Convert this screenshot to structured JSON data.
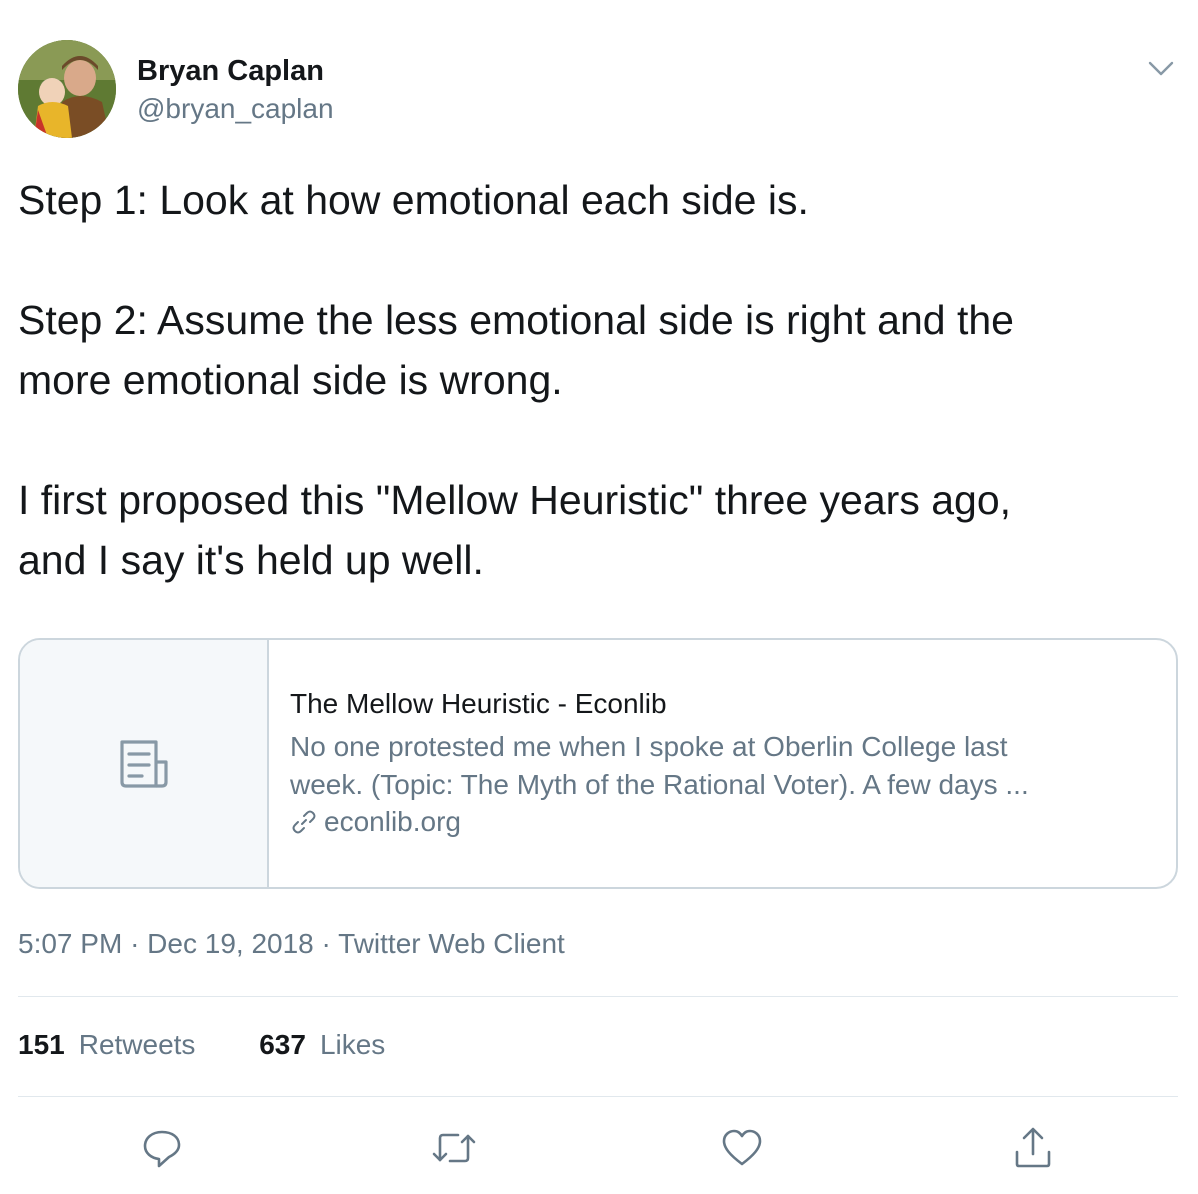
{
  "author": {
    "display_name": "Bryan Caplan",
    "handle": "@bryan_caplan"
  },
  "tweet": {
    "paragraphs": [
      "Step 1: Look at how emotional each side is.",
      "Step 2: Assume the less emotional side is right and the more emotional side is wrong.",
      "I first proposed this \"Mellow Heuristic\" three years ago, and I say it's held up well."
    ],
    "lines": [
      [
        "Step 1: Look at how emotional each side is."
      ],
      [
        "Step 2: Assume the less emotional side is right and the",
        "more emotional side is wrong."
      ],
      [
        "I first proposed this \"Mellow Heuristic\" three years ago,",
        "and I say it's held up well."
      ]
    ]
  },
  "card": {
    "title": "The Mellow Heuristic - Econlib",
    "description_lines": [
      "No one protested me when I spoke at Oberlin College last",
      "week.  (Topic: The Myth of the Rational Voter).  A few days ..."
    ],
    "domain": "econlib.org"
  },
  "meta": {
    "time": "5:07 PM",
    "separator": "·",
    "date": "Dec 19, 2018",
    "client": "Twitter Web Client"
  },
  "stats": {
    "retweets_count": "151",
    "retweets_label": "Retweets",
    "likes_count": "637",
    "likes_label": "Likes"
  },
  "icons": {
    "caret": "chevron-down-icon",
    "card_thumb": "document-icon",
    "domain_link": "link-icon",
    "reply": "reply-icon",
    "retweet": "retweet-icon",
    "like": "heart-icon",
    "share": "share-icon"
  },
  "colors": {
    "text": "#14171a",
    "secondary": "#657786",
    "border": "#ccd6dd",
    "card_thumb_bg": "#f5f8fa"
  }
}
